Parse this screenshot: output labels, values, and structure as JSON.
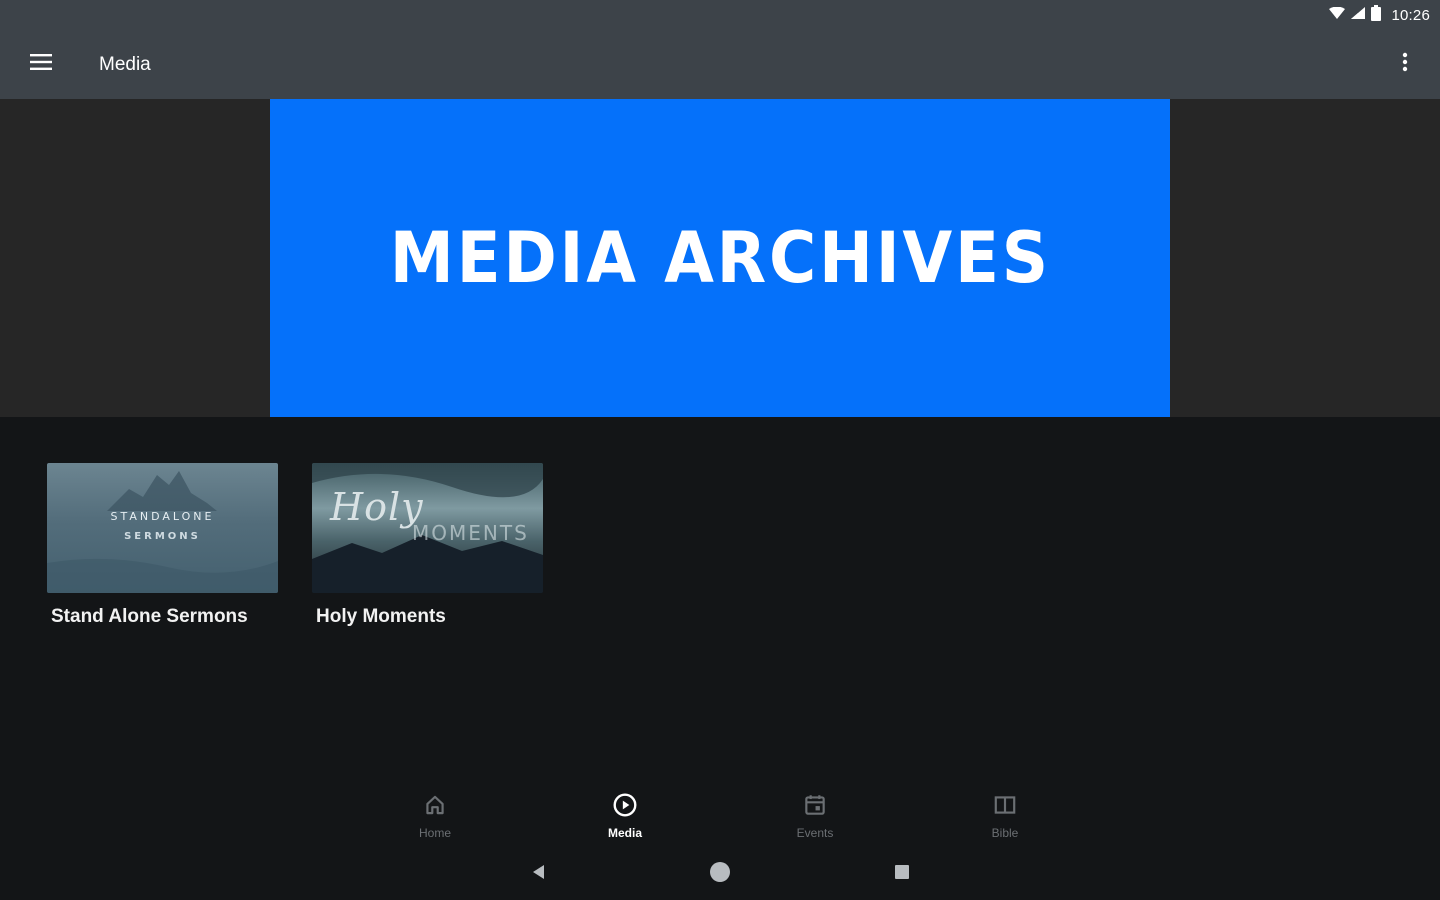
{
  "status_bar": {
    "time": "10:26",
    "icons": [
      "wifi-icon",
      "signal-icon",
      "battery-icon"
    ]
  },
  "app_bar": {
    "title": "Media",
    "menu_icon": "hamburger-menu-icon",
    "overflow_icon": "more-vert-icon"
  },
  "hero": {
    "text": "MEDIA ARCHIVES",
    "background_color": "#0571fa"
  },
  "media_items": [
    {
      "label": "Stand Alone Sermons",
      "thumb_line1": "STANDALONE",
      "thumb_line2": "SERMONS"
    },
    {
      "label": "Holy Moments",
      "thumb_script": "Holy",
      "thumb_caps": "MOMENTS"
    }
  ],
  "bottom_nav": {
    "items": [
      {
        "label": "Home",
        "icon": "home-icon",
        "active": false
      },
      {
        "label": "Media",
        "icon": "play-circle-icon",
        "active": true
      },
      {
        "label": "Events",
        "icon": "calendar-icon",
        "active": false
      },
      {
        "label": "Bible",
        "icon": "book-icon",
        "active": false
      }
    ]
  },
  "system_nav": {
    "icons": [
      "back-icon",
      "home-circle-icon",
      "recents-icon"
    ]
  },
  "colors": {
    "app_bar": "#3d4349",
    "background": "#131517",
    "hero_side": "#262626",
    "accent": "#0571fa"
  }
}
